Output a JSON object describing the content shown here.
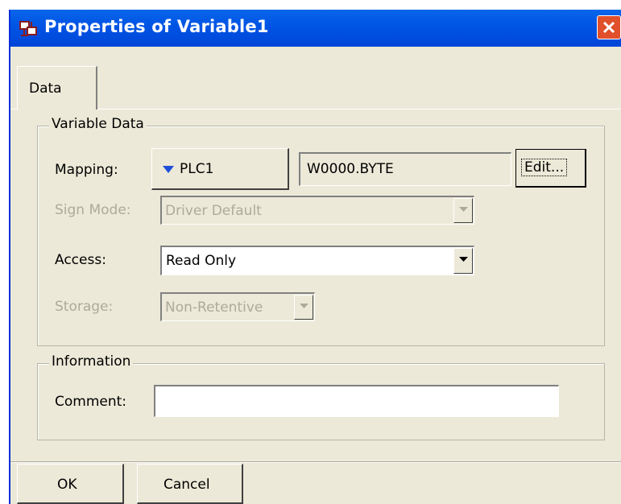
{
  "window": {
    "title": "Properties of Variable1",
    "icon": "properties-icon",
    "close_icon": "close-icon"
  },
  "tabs": [
    {
      "label": "Data"
    }
  ],
  "variable_data": {
    "legend": "Variable Data",
    "mapping": {
      "label": "Mapping:",
      "device": "PLC1",
      "address": "W0000.BYTE",
      "edit_label": "Edit..."
    },
    "sign_mode": {
      "label": "Sign Mode:",
      "value": "Driver Default"
    },
    "access": {
      "label": "Access:",
      "value": "Read Only"
    },
    "storage": {
      "label": "Storage:",
      "value": "Non-Retentive"
    }
  },
  "information": {
    "legend": "Information",
    "comment": {
      "label": "Comment:",
      "value": ""
    }
  },
  "buttons": {
    "ok": "OK",
    "cancel": "Cancel"
  },
  "colors": {
    "titlebar": "#0055e5",
    "close": "#e0502a",
    "dialog_bg": "#ece9d8",
    "disabled_text": "#acaa99",
    "dropdown_arrow": "#1e4fd8"
  }
}
